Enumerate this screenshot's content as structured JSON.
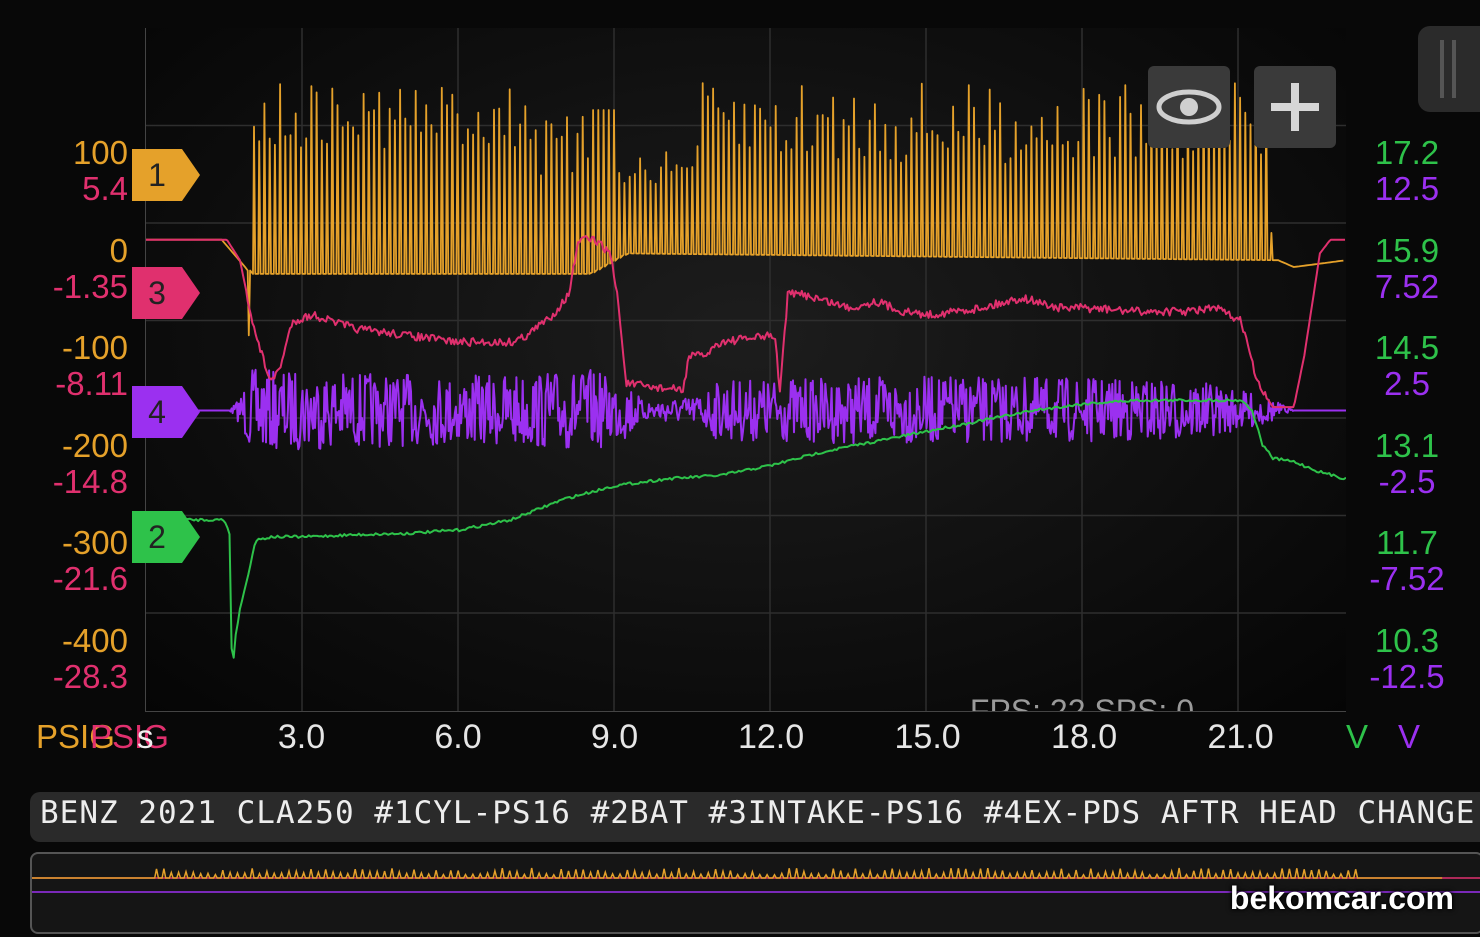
{
  "chart_data": {
    "type": "line",
    "x_axis": {
      "unit": "s",
      "ticks": [
        "3.0",
        "6.0",
        "9.0",
        "12.0",
        "15.0",
        "18.0",
        "21.0"
      ]
    },
    "channels": [
      {
        "id": "1",
        "unit": "PSIG",
        "color": "#e5a12a",
        "axis_side": "left",
        "ticks": [
          "100",
          "0",
          "-100",
          "-200",
          "-300",
          "-400"
        ]
      },
      {
        "id": "3",
        "unit": "PSIG",
        "color": "#e0306e",
        "axis_side": "left",
        "ticks": [
          "5.4",
          "-1.35",
          "-8.11",
          "-14.8",
          "-21.6",
          "-28.3"
        ]
      },
      {
        "id": "2",
        "unit": "V",
        "color": "#2ec24a",
        "axis_side": "right",
        "ticks": [
          "17.2",
          "15.9",
          "14.5",
          "13.1",
          "11.7",
          "10.3"
        ]
      },
      {
        "id": "4",
        "unit": "V",
        "color": "#9b30f0",
        "axis_side": "right",
        "ticks": [
          "12.5",
          "7.52",
          "2.5",
          "-2.5",
          "-7.52",
          "-12.5"
        ]
      }
    ],
    "markers": [
      {
        "label": "1",
        "color": "#e5a12a"
      },
      {
        "label": "3",
        "color": "#e0306e"
      },
      {
        "label": "4",
        "color": "#9b30f0"
      },
      {
        "label": "2",
        "color": "#2ec24a"
      }
    ],
    "series_shapes": {
      "ch1": [
        [
          0,
          0.31
        ],
        [
          1.45,
          0.31
        ],
        [
          1.9,
          0.35
        ],
        [
          2.0,
          0.36
        ],
        [
          8.5,
          0.36
        ],
        [
          9.2,
          0.33
        ],
        [
          21.7,
          0.34
        ],
        [
          22.0,
          0.35
        ],
        [
          23.0,
          0.34
        ]
      ],
      "ch3": [
        [
          0,
          0.31
        ],
        [
          1.55,
          0.31
        ],
        [
          1.8,
          0.34
        ],
        [
          2.1,
          0.45
        ],
        [
          2.4,
          0.52
        ],
        [
          2.6,
          0.49
        ],
        [
          2.8,
          0.43
        ],
        [
          3.2,
          0.42
        ],
        [
          4.0,
          0.44
        ],
        [
          5.0,
          0.45
        ],
        [
          6.0,
          0.46
        ],
        [
          7.0,
          0.46
        ],
        [
          7.3,
          0.45
        ],
        [
          7.8,
          0.42
        ],
        [
          8.1,
          0.39
        ],
        [
          8.3,
          0.31
        ],
        [
          8.6,
          0.31
        ],
        [
          8.9,
          0.33
        ],
        [
          9.05,
          0.4
        ],
        [
          9.2,
          0.52
        ],
        [
          9.6,
          0.525
        ],
        [
          10.3,
          0.53
        ],
        [
          10.4,
          0.48
        ],
        [
          10.7,
          0.48
        ],
        [
          11.0,
          0.46
        ],
        [
          11.5,
          0.455
        ],
        [
          12.05,
          0.45
        ],
        [
          12.15,
          0.53
        ],
        [
          12.3,
          0.39
        ],
        [
          12.6,
          0.39
        ],
        [
          13.5,
          0.41
        ],
        [
          14.0,
          0.4
        ],
        [
          14.5,
          0.415
        ],
        [
          15.0,
          0.42
        ],
        [
          16.0,
          0.41
        ],
        [
          16.8,
          0.395
        ],
        [
          17.5,
          0.41
        ],
        [
          18.0,
          0.41
        ],
        [
          19.0,
          0.415
        ],
        [
          20.0,
          0.415
        ],
        [
          20.5,
          0.41
        ],
        [
          21.0,
          0.43
        ],
        [
          21.3,
          0.52
        ],
        [
          21.6,
          0.555
        ],
        [
          22.0,
          0.555
        ],
        [
          22.2,
          0.48
        ],
        [
          22.5,
          0.33
        ],
        [
          22.7,
          0.31
        ],
        [
          23.0,
          0.31
        ]
      ],
      "ch2": [
        [
          0,
          0.72
        ],
        [
          1.5,
          0.72
        ],
        [
          1.6,
          0.74
        ],
        [
          1.65,
          0.95
        ],
        [
          1.7,
          0.9
        ],
        [
          1.8,
          0.85
        ],
        [
          1.9,
          0.82
        ],
        [
          2.1,
          0.75
        ],
        [
          2.4,
          0.745
        ],
        [
          3.0,
          0.745
        ],
        [
          4.0,
          0.742
        ],
        [
          5.0,
          0.74
        ],
        [
          6.0,
          0.735
        ],
        [
          7.0,
          0.72
        ],
        [
          8.0,
          0.69
        ],
        [
          9.0,
          0.67
        ],
        [
          10.0,
          0.66
        ],
        [
          11.0,
          0.655
        ],
        [
          12.0,
          0.64
        ],
        [
          13.0,
          0.62
        ],
        [
          14.0,
          0.605
        ],
        [
          15.0,
          0.59
        ],
        [
          16.0,
          0.575
        ],
        [
          17.0,
          0.56
        ],
        [
          18.0,
          0.55
        ],
        [
          19.0,
          0.545
        ],
        [
          20.0,
          0.545
        ],
        [
          21.0,
          0.545
        ],
        [
          21.2,
          0.56
        ],
        [
          21.4,
          0.61
        ],
        [
          21.6,
          0.63
        ],
        [
          22.0,
          0.635
        ],
        [
          22.5,
          0.65
        ],
        [
          23.0,
          0.66
        ]
      ],
      "ch4_base": 0.56,
      "ch4_amp": [
        [
          0,
          0.0
        ],
        [
          1.6,
          0.0
        ],
        [
          1.8,
          0.02
        ],
        [
          2.0,
          0.06
        ],
        [
          4.0,
          0.055
        ],
        [
          6.0,
          0.05
        ],
        [
          8.5,
          0.06
        ],
        [
          9.3,
          0.04
        ],
        [
          9.5,
          0.015
        ],
        [
          10.5,
          0.02
        ],
        [
          11.0,
          0.045
        ],
        [
          15.0,
          0.05
        ],
        [
          20.0,
          0.045
        ],
        [
          21.5,
          0.02
        ],
        [
          22.0,
          0.0
        ],
        [
          23.0,
          0.0
        ]
      ]
    }
  },
  "toolbar": {
    "eye_icon": "eye-icon",
    "add_icon": "plus-icon"
  },
  "status": {
    "fps": "FPS: 22  SPS: 0"
  },
  "title": {
    "text": "BENZ 2021 CLA250 #1CYL-PS16 #2BAT #3INTAKE-PS16 #4EX-PDS AFTR HEAD CHANGE"
  },
  "overview": {
    "label": "overview-strip"
  },
  "watermark": {
    "text": "bekomcar.com"
  }
}
